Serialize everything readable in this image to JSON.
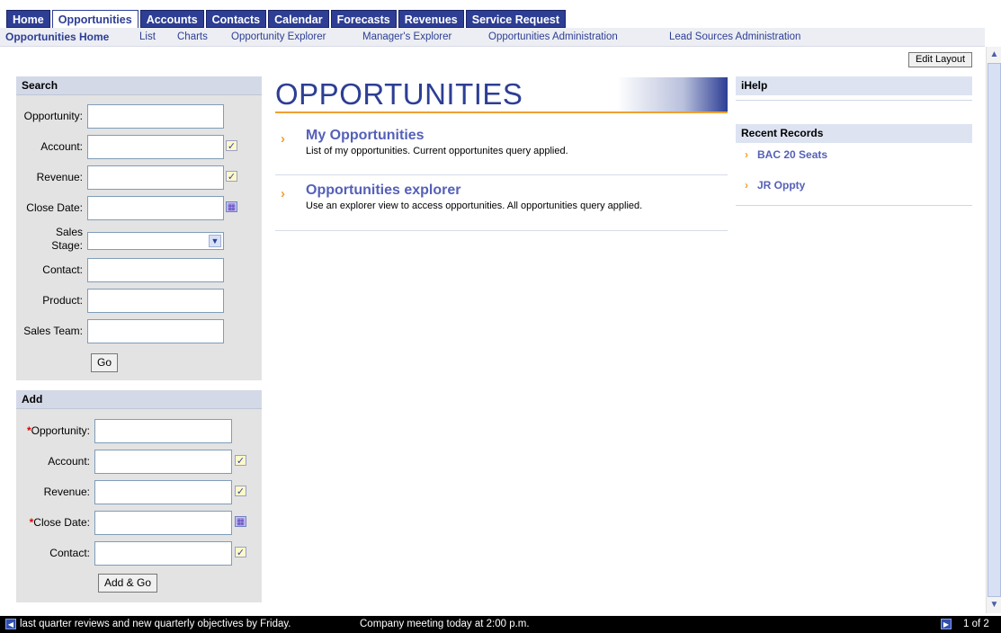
{
  "tabs": [
    "Home",
    "Opportunities",
    "Accounts",
    "Contacts",
    "Calendar",
    "Forecasts",
    "Revenues",
    "Service Request"
  ],
  "subnav": [
    "Opportunities Home",
    "List",
    "Charts",
    "Opportunity Explorer",
    "Manager's Explorer",
    "Opportunities Administration",
    "Lead Sources Administration"
  ],
  "edit_layout": "Edit Layout",
  "search": {
    "title": "Search",
    "fields": [
      "Opportunity:",
      "Account:",
      "Revenue:",
      "Close Date:",
      "Sales Stage:",
      "Contact:",
      "Product:",
      "Sales Team:"
    ],
    "go": "Go"
  },
  "add": {
    "title": "Add",
    "fields": [
      "Opportunity:",
      "Account:",
      "Revenue:",
      "Close Date:",
      "Contact:"
    ],
    "required_mark": "*",
    "button": "Add & Go"
  },
  "main": {
    "title": "OPPORTUNITIES",
    "items": [
      {
        "title": "My Opportunities",
        "desc": "List of my opportunities. Current opportunites query applied."
      },
      {
        "title": "Opportunities explorer",
        "desc": "Use an explorer view to access opportunities. All opportunities query applied."
      }
    ]
  },
  "right": {
    "ihelp": "iHelp",
    "recent_title": "Recent Records",
    "recent": [
      "BAC 20 Seats",
      "JR Oppty"
    ]
  },
  "ticker": {
    "message1": "last quarter reviews and new quarterly objectives by Friday.",
    "message2": "Company meeting today at 2:00 p.m.",
    "page": "1 of 2"
  },
  "icons": {
    "chevron": "›",
    "calendar": "▦",
    "picker": "✓"
  }
}
